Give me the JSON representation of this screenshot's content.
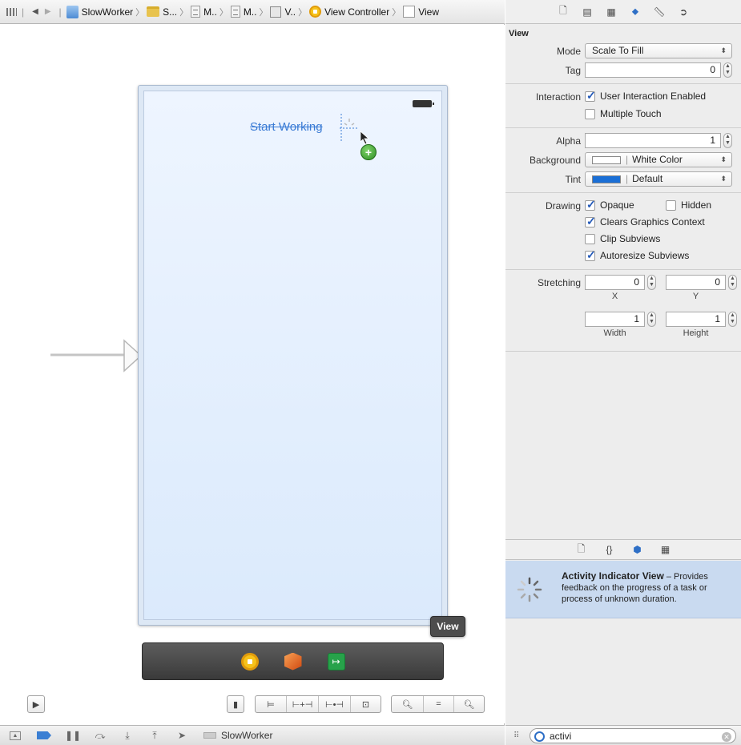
{
  "jumpbar": {
    "items": [
      "SlowWorker",
      "S...",
      "M..",
      "M..",
      "V..",
      "View Controller",
      "View"
    ]
  },
  "canvas": {
    "button_title": "Start Working",
    "add_badge": "+",
    "tooltip": "View"
  },
  "inspector": {
    "section_title": "View",
    "mode": {
      "label": "Mode",
      "value": "Scale To Fill"
    },
    "tag": {
      "label": "Tag",
      "value": "0"
    },
    "interaction": {
      "label": "Interaction",
      "user_interaction": "User Interaction Enabled",
      "multiple_touch": "Multiple Touch"
    },
    "alpha": {
      "label": "Alpha",
      "value": "1"
    },
    "background": {
      "label": "Background",
      "value": "White Color",
      "swatch": "#ffffff"
    },
    "tint": {
      "label": "Tint",
      "value": "Default",
      "swatch": "#1a6fd6"
    },
    "drawing": {
      "label": "Drawing",
      "opaque": "Opaque",
      "hidden": "Hidden",
      "clears": "Clears Graphics Context",
      "clip": "Clip Subviews",
      "autoresize": "Autoresize Subviews"
    },
    "stretching": {
      "label": "Stretching",
      "x": "0",
      "y": "0",
      "width": "1",
      "height": "1",
      "x_label": "X",
      "y_label": "Y",
      "width_label": "Width",
      "height_label": "Height"
    }
  },
  "library": {
    "item_title": "Activity Indicator View",
    "item_desc": " – Provides feedback on the progress of a task or process of unknown duration."
  },
  "filter": {
    "value": "activi"
  },
  "debugbar": {
    "target": "SlowWorker"
  },
  "colors": {
    "accent": "#3a7bd5",
    "selection": "#c9daf0",
    "dock": "#4a4a4a"
  }
}
